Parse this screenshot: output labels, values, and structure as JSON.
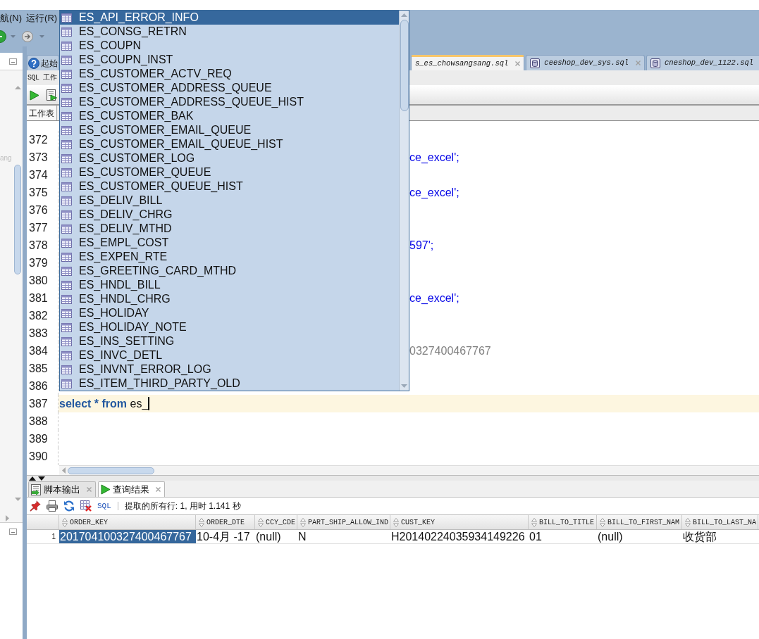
{
  "menu_bar": {
    "items": [
      {
        "label": "航(N)"
      },
      {
        "label": "运行(R)"
      }
    ]
  },
  "side_panel": {
    "tree_items": [
      {
        "label": "ang"
      }
    ]
  },
  "editor_tabs": [
    {
      "label": "起始",
      "kind": "start",
      "selected": false
    },
    {
      "label": "s_es_chowsangsang.sql",
      "kind": "file",
      "selected": true
    },
    {
      "label": "ceeshop_dev_sys.sql",
      "kind": "database",
      "selected": false
    },
    {
      "label": "cneshop_dev_1122.sql",
      "kind": "database",
      "selected": false
    }
  ],
  "worksheet": {
    "header": "SQL 工作",
    "tab": "工作表"
  },
  "editor": {
    "lines": [
      {
        "number": "372",
        "current": false
      },
      {
        "number": "373",
        "current": false,
        "tail": {
          "kind": "string",
          "text": "ce_excel';"
        }
      },
      {
        "number": "374",
        "current": false
      },
      {
        "number": "375",
        "current": false,
        "tail": {
          "kind": "string",
          "text": "ce_excel';"
        }
      },
      {
        "number": "376",
        "current": false
      },
      {
        "number": "377",
        "current": false
      },
      {
        "number": "378",
        "current": false,
        "tail": {
          "kind": "string",
          "text": "597';"
        }
      },
      {
        "number": "379",
        "current": false
      },
      {
        "number": "380",
        "current": false
      },
      {
        "number": "381",
        "current": false,
        "tail": {
          "kind": "string",
          "text": "ce_excel';"
        }
      },
      {
        "number": "382",
        "current": false
      },
      {
        "number": "383",
        "current": false
      },
      {
        "number": "384",
        "current": false,
        "tail": {
          "kind": "comment",
          "text": "0327400467767"
        }
      },
      {
        "number": "385",
        "current": false
      },
      {
        "number": "386",
        "current": false
      },
      {
        "number": "387",
        "current": true,
        "text": "**select * from** es_"
      },
      {
        "number": "388",
        "current": false
      },
      {
        "number": "389",
        "current": false
      },
      {
        "number": "390",
        "current": false
      }
    ]
  },
  "autocomplete": {
    "items": [
      {
        "label": "ES_API_ERROR_INFO",
        "selected": true
      },
      {
        "label": "ES_CONSG_RETRN",
        "selected": false
      },
      {
        "label": "ES_COUPN",
        "selected": false
      },
      {
        "label": "ES_COUPN_INST",
        "selected": false
      },
      {
        "label": "ES_CUSTOMER_ACTV_REQ",
        "selected": false
      },
      {
        "label": "ES_CUSTOMER_ADDRESS_QUEUE",
        "selected": false
      },
      {
        "label": "ES_CUSTOMER_ADDRESS_QUEUE_HIST",
        "selected": false
      },
      {
        "label": "ES_CUSTOMER_BAK",
        "selected": false
      },
      {
        "label": "ES_CUSTOMER_EMAIL_QUEUE",
        "selected": false
      },
      {
        "label": "ES_CUSTOMER_EMAIL_QUEUE_HIST",
        "selected": false
      },
      {
        "label": "ES_CUSTOMER_LOG",
        "selected": false
      },
      {
        "label": "ES_CUSTOMER_QUEUE",
        "selected": false
      },
      {
        "label": "ES_CUSTOMER_QUEUE_HIST",
        "selected": false
      },
      {
        "label": "ES_DELIV_BILL",
        "selected": false
      },
      {
        "label": "ES_DELIV_CHRG",
        "selected": false
      },
      {
        "label": "ES_DELIV_MTHD",
        "selected": false
      },
      {
        "label": "ES_EMPL_COST",
        "selected": false
      },
      {
        "label": "ES_EXPEN_RTE",
        "selected": false
      },
      {
        "label": "ES_GREETING_CARD_MTHD",
        "selected": false
      },
      {
        "label": "ES_HNDL_BILL",
        "selected": false
      },
      {
        "label": "ES_HNDL_CHRG",
        "selected": false
      },
      {
        "label": "ES_HOLIDAY",
        "selected": false
      },
      {
        "label": "ES_HOLIDAY_NOTE",
        "selected": false
      },
      {
        "label": "ES_INS_SETTING",
        "selected": false
      },
      {
        "label": "ES_INVC_DETL",
        "selected": false
      },
      {
        "label": "ES_INVNT_ERROR_LOG",
        "selected": false
      },
      {
        "label": "ES_ITEM_THIRD_PARTY_OLD",
        "selected": false
      }
    ]
  },
  "output_tabs": [
    {
      "label": "脚本输出",
      "kind": "script",
      "selected": false
    },
    {
      "label": "查询结果",
      "kind": "run",
      "selected": true
    }
  ],
  "results_toolbar": {
    "sql_link": "SQL",
    "status": "提取的所有行: 1, 用时 1.141 秒"
  },
  "results_table": {
    "columns": [
      "ORDER_KEY",
      "ORDER_DTE",
      "CCY_CDE",
      "PART_SHIP_ALLOW_IND",
      "CUST_KEY",
      "BILL_TO_TITLE",
      "BILL_TO_FIRST_NAM",
      "BILL_TO_LAST_NA"
    ],
    "rows": [
      {
        "number": "1",
        "cells": [
          {
            "text": "201704100327400467767",
            "selected": true
          },
          {
            "text": "10-4月 -17",
            "selected": false
          },
          {
            "text": "(null)",
            "selected": false
          },
          {
            "text": "N",
            "selected": false
          },
          {
            "text": "H20140224035934149226",
            "selected": false
          },
          {
            "text": "01",
            "selected": false
          },
          {
            "text": "(null)",
            "selected": false
          },
          {
            "text": "收货部",
            "selected": false
          }
        ]
      }
    ]
  }
}
